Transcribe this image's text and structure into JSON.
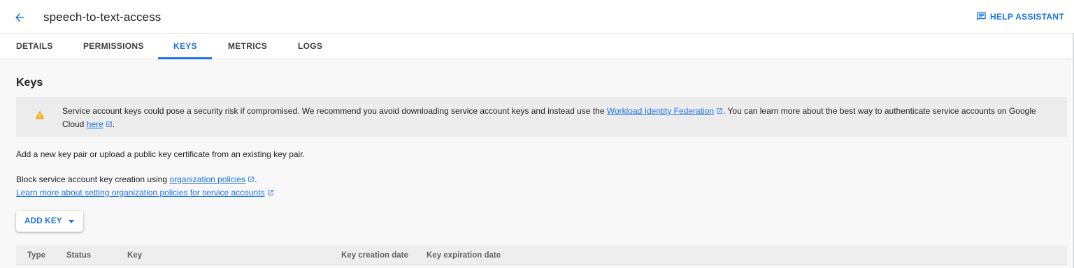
{
  "header": {
    "back_icon": "arrow-back-icon",
    "title": "speech-to-text-access",
    "help_icon": "feedback-chat-icon",
    "help_label": "HELP ASSISTANT"
  },
  "tabs": [
    {
      "label": "DETAILS"
    },
    {
      "label": "PERMISSIONS"
    },
    {
      "label": "KEYS",
      "active": true
    },
    {
      "label": "METRICS"
    },
    {
      "label": "LOGS"
    }
  ],
  "section_title": "Keys",
  "warning": {
    "icon": "warning-triangle-icon",
    "text_before": "Service account keys could pose a security risk if compromised. We recommend you avoid downloading service account keys and instead use the ",
    "link1": "Workload Identity Federation",
    "text_middle": ". You can learn more about the best way to authenticate service accounts on Google Cloud ",
    "link2": "here",
    "text_after": "."
  },
  "intro": "Add a new key pair or upload a public key certificate from an existing key pair.",
  "policy": {
    "text_before": "Block service account key creation using ",
    "link": "organization policies",
    "text_after": ".",
    "learn_link": "Learn more about setting organization policies for service accounts"
  },
  "add_key_label": "ADD KEY",
  "table": {
    "columns": [
      "Type",
      "Status",
      "Key",
      "Key creation date",
      "Key expiration date"
    ]
  },
  "colors": {
    "accent": "#1a73e8",
    "warning": "#f9ab00"
  }
}
